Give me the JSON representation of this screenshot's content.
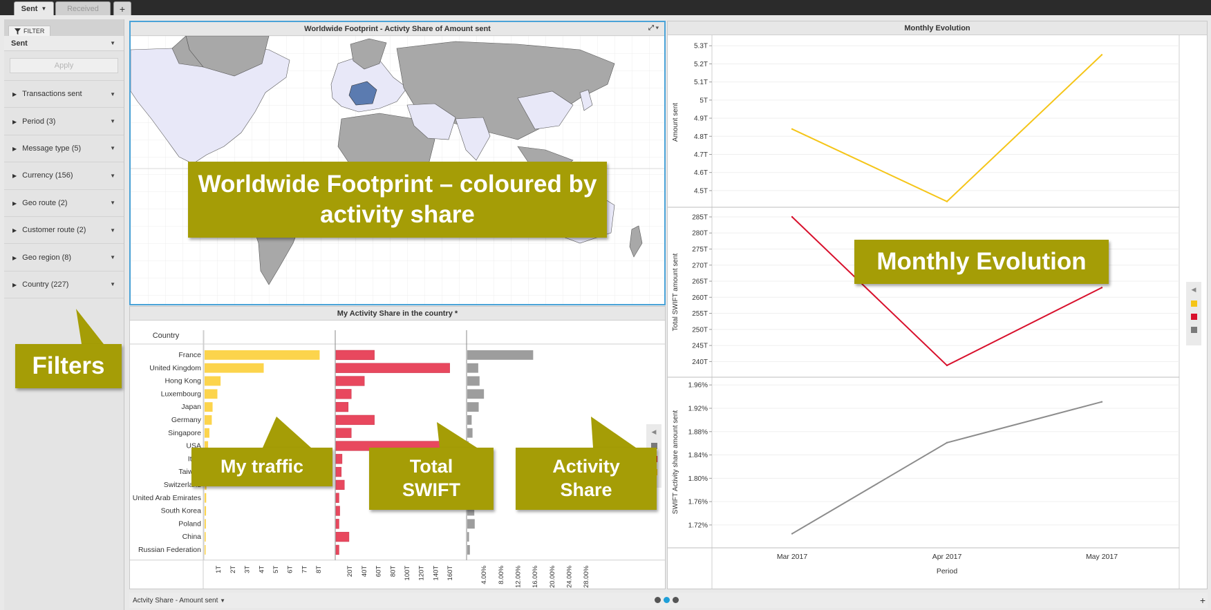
{
  "tabs": [
    {
      "label": "Sent",
      "active": true
    },
    {
      "label": "Received",
      "active": false
    }
  ],
  "add_tab_label": "+",
  "filter": {
    "tab_label": "FILTER",
    "selected": "Sent",
    "apply_label": "Apply",
    "items": [
      {
        "label": "Transactions sent"
      },
      {
        "label": "Period (3)"
      },
      {
        "label": "Message type (5)"
      },
      {
        "label": "Currency (156)"
      },
      {
        "label": "Geo route (2)"
      },
      {
        "label": "Customer route (2)"
      },
      {
        "label": "Geo region (8)"
      },
      {
        "label": "Country (227)"
      }
    ]
  },
  "map_panel": {
    "title": "Worldwide Footprint - Activty Share of Amount sent"
  },
  "activity_panel": {
    "title": "My Activity Share in the country *",
    "country_header": "Country"
  },
  "monthly_panel": {
    "title": "Monthly Evolution"
  },
  "bottom": {
    "axis_label": "Actvity Share - Amount sent"
  },
  "colors": {
    "yellow": "#fcd44c",
    "red": "#e8485e",
    "grey": "#9d9d9d",
    "line_yellow": "#f5c518",
    "line_red": "#d8102c",
    "line_grey": "#8c8c8c",
    "callout": "#a59d06",
    "map_highlight": "#5b7bb0",
    "map_light": "#e8e8f8"
  },
  "callouts": {
    "map": "Worldwide Footprint – coloured by activity share",
    "monthly": "Monthly Evolution",
    "filters": "Filters",
    "my_traffic": "My traffic",
    "total_swift": "Total SWIFT",
    "activity_share": "Activity Share"
  },
  "chart_data": [
    {
      "type": "bar",
      "title": "My Activity Share in the country *",
      "categories": [
        "France",
        "United Kingdom",
        "Hong Kong",
        "Luxembourg",
        "Japan",
        "Germany",
        "Singapore",
        "USA",
        "Italy",
        "Taiwan",
        "Switzerland",
        "United Arab Emirates",
        "South Korea",
        "Poland",
        "China",
        "Russian Federation"
      ],
      "series": [
        {
          "name": "Amount sent",
          "unit": "T",
          "ticks": [
            "1T",
            "2T",
            "3T",
            "4T",
            "5T",
            "6T",
            "7T",
            "8T"
          ],
          "xlim": [
            0,
            7.7
          ],
          "values": [
            7.2,
            3.7,
            1.0,
            0.8,
            0.5,
            0.45,
            0.3,
            0.22,
            0.18,
            0.15,
            0.12,
            0.1,
            0.09,
            0.08,
            0.07,
            0.06
          ]
        },
        {
          "name": "Total SWIFT amount sent",
          "unit": "T",
          "ticks": [
            "20T",
            "40T",
            "60T",
            "80T",
            "100T",
            "120T",
            "140T",
            "160T"
          ],
          "xlim": [
            0,
            160
          ],
          "values": [
            50,
            148,
            37,
            20,
            16,
            50,
            20,
            157,
            8,
            7,
            11,
            4,
            5,
            4,
            17,
            4
          ]
        },
        {
          "name": "SWIFT Activity share amount sent",
          "unit": "%",
          "ticks": [
            "4.00%",
            "8.00%",
            "12.00%",
            "16.00%",
            "20.00%",
            "24.00%",
            "28.00%"
          ],
          "xlim": [
            0,
            28
          ],
          "values": [
            15.0,
            2.5,
            2.8,
            3.8,
            2.6,
            1.0,
            1.2,
            0.3,
            1.6,
            1.6,
            1.6,
            1.9,
            1.6,
            1.7,
            0.4,
            0.6
          ]
        }
      ],
      "sort_icon": "⇂↑"
    },
    {
      "type": "line",
      "title": "Monthly Evolution",
      "categories": [
        "Mar 2017",
        "Apr 2017",
        "May 2017"
      ],
      "xlabel": "Period",
      "panels": [
        {
          "ylabel": "Amount sent",
          "ticks": [
            "4.5T",
            "4.6T",
            "4.7T",
            "4.8T",
            "4.9T",
            "5T",
            "5.1T",
            "5.2T",
            "5.3T"
          ],
          "ylim": [
            4.45,
            5.32
          ],
          "values": [
            4.84,
            4.44,
            5.25
          ],
          "color": "#f5c518"
        },
        {
          "ylabel": "Total SWIFT amount sent",
          "ticks": [
            "240T",
            "245T",
            "250T",
            "255T",
            "260T",
            "265T",
            "270T",
            "275T",
            "280T",
            "285T"
          ],
          "ylim": [
            237.5,
            286.5
          ],
          "values": [
            285,
            238.8,
            263
          ],
          "color": "#d8102c"
        },
        {
          "ylabel": "SWIFT Activity share amount sent",
          "ticks": [
            "1.72%",
            "1.76%",
            "1.80%",
            "1.84%",
            "1.88%",
            "1.92%",
            "1.96%"
          ],
          "ylim": [
            1.695,
            1.965
          ],
          "values": [
            1.705,
            1.861,
            1.931
          ],
          "color": "#8c8c8c"
        }
      ]
    }
  ]
}
